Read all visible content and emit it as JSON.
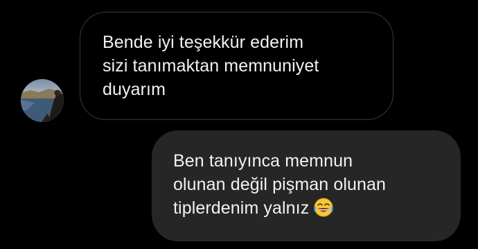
{
  "messages": [
    {
      "direction": "incoming",
      "text": "Bende iyi teşekkür ederim\nsizi tanımaktan memnuniyet\nduyarım",
      "avatar": "profile-photo-lake-silhouette"
    },
    {
      "direction": "outgoing",
      "text": "Ben tanıyınca memnun\nolunan değil pişman olunan\ntiplerdenim yalnız",
      "emoji": "face-with-tears-of-joy-icon"
    }
  ],
  "colors": {
    "background": "#000000",
    "incoming_border": "#3a3a3a",
    "outgoing_bubble": "#262626",
    "text": "#f2f2f2"
  }
}
